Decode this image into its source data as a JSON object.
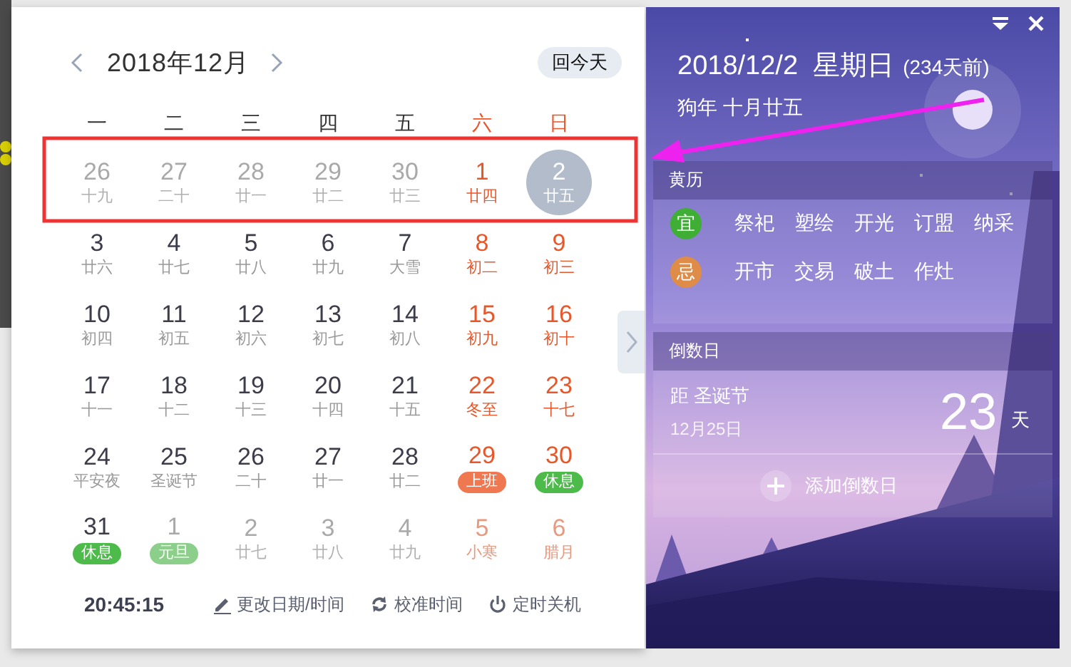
{
  "calendar": {
    "title": "2018年12月",
    "today_button": "回今天",
    "weekdays": [
      "一",
      "二",
      "三",
      "四",
      "五",
      "六",
      "日"
    ],
    "days": [
      {
        "day": "26",
        "label": "十九",
        "kind": "plain",
        "faded": true,
        "selected": false
      },
      {
        "day": "27",
        "label": "二十",
        "kind": "plain",
        "faded": true,
        "selected": false
      },
      {
        "day": "28",
        "label": "廿一",
        "kind": "plain",
        "faded": true,
        "selected": false
      },
      {
        "day": "29",
        "label": "廿二",
        "kind": "plain",
        "faded": true,
        "selected": false
      },
      {
        "day": "30",
        "label": "廿三",
        "kind": "plain",
        "faded": true,
        "selected": false
      },
      {
        "day": "1",
        "label": "廿四",
        "kind": "plain",
        "faded": false,
        "selected": false
      },
      {
        "day": "2",
        "label": "廿五",
        "kind": "plain",
        "faded": false,
        "selected": true
      },
      {
        "day": "3",
        "label": "廿六",
        "kind": "plain",
        "faded": false,
        "selected": false
      },
      {
        "day": "4",
        "label": "廿七",
        "kind": "plain",
        "faded": false,
        "selected": false
      },
      {
        "day": "5",
        "label": "廿八",
        "kind": "plain",
        "faded": false,
        "selected": false
      },
      {
        "day": "6",
        "label": "廿九",
        "kind": "plain",
        "faded": false,
        "selected": false
      },
      {
        "day": "7",
        "label": "大雪",
        "kind": "plain",
        "faded": false,
        "selected": false
      },
      {
        "day": "8",
        "label": "初二",
        "kind": "plain",
        "faded": false,
        "selected": false
      },
      {
        "day": "9",
        "label": "初三",
        "kind": "plain",
        "faded": false,
        "selected": false
      },
      {
        "day": "10",
        "label": "初四",
        "kind": "plain",
        "faded": false,
        "selected": false
      },
      {
        "day": "11",
        "label": "初五",
        "kind": "plain",
        "faded": false,
        "selected": false
      },
      {
        "day": "12",
        "label": "初六",
        "kind": "plain",
        "faded": false,
        "selected": false
      },
      {
        "day": "13",
        "label": "初七",
        "kind": "plain",
        "faded": false,
        "selected": false
      },
      {
        "day": "14",
        "label": "初八",
        "kind": "plain",
        "faded": false,
        "selected": false
      },
      {
        "day": "15",
        "label": "初九",
        "kind": "plain",
        "faded": false,
        "selected": false
      },
      {
        "day": "16",
        "label": "初十",
        "kind": "plain",
        "faded": false,
        "selected": false
      },
      {
        "day": "17",
        "label": "十一",
        "kind": "plain",
        "faded": false,
        "selected": false
      },
      {
        "day": "18",
        "label": "十二",
        "kind": "plain",
        "faded": false,
        "selected": false
      },
      {
        "day": "19",
        "label": "十三",
        "kind": "plain",
        "faded": false,
        "selected": false
      },
      {
        "day": "20",
        "label": "十四",
        "kind": "plain",
        "faded": false,
        "selected": false
      },
      {
        "day": "21",
        "label": "十五",
        "kind": "plain",
        "faded": false,
        "selected": false
      },
      {
        "day": "22",
        "label": "冬至",
        "kind": "plain",
        "faded": false,
        "selected": false
      },
      {
        "day": "23",
        "label": "十七",
        "kind": "plain",
        "faded": false,
        "selected": false
      },
      {
        "day": "24",
        "label": "平安夜",
        "kind": "plain",
        "faded": false,
        "selected": false
      },
      {
        "day": "25",
        "label": "圣诞节",
        "kind": "plain",
        "faded": false,
        "selected": false
      },
      {
        "day": "26",
        "label": "二十",
        "kind": "plain",
        "faded": false,
        "selected": false
      },
      {
        "day": "27",
        "label": "廿一",
        "kind": "plain",
        "faded": false,
        "selected": false
      },
      {
        "day": "28",
        "label": "廿二",
        "kind": "plain",
        "faded": false,
        "selected": false
      },
      {
        "day": "29",
        "label": "上班",
        "kind": "work",
        "faded": false,
        "selected": false
      },
      {
        "day": "30",
        "label": "休息",
        "kind": "rest",
        "faded": false,
        "selected": false
      },
      {
        "day": "31",
        "label": "休息",
        "kind": "rest",
        "faded": false,
        "selected": false
      },
      {
        "day": "1",
        "label": "元旦",
        "kind": "rest",
        "faded": true,
        "selected": false
      },
      {
        "day": "2",
        "label": "廿七",
        "kind": "plain",
        "faded": true,
        "selected": false
      },
      {
        "day": "3",
        "label": "廿八",
        "kind": "plain",
        "faded": true,
        "selected": false
      },
      {
        "day": "4",
        "label": "廿九",
        "kind": "plain",
        "faded": true,
        "selected": false
      },
      {
        "day": "5",
        "label": "小寒",
        "kind": "plain",
        "faded": true,
        "selected": false
      },
      {
        "day": "6",
        "label": "腊月",
        "kind": "plain",
        "faded": true,
        "selected": false
      }
    ],
    "clock": "20:45:15",
    "actions": [
      {
        "kind": "edit",
        "label": "更改日期/时间"
      },
      {
        "kind": "sync",
        "label": "校准时间"
      },
      {
        "kind": "power",
        "label": "定时关机"
      }
    ]
  },
  "panel": {
    "date": "2018/12/2  星期日",
    "ago": "(234天前)",
    "lunar": "狗年 十月廿五",
    "almanac": {
      "title": "黄历",
      "rows": [
        {
          "kind": "good",
          "mark": "宜",
          "items": [
            "祭祀",
            "塑绘",
            "开光",
            "订盟",
            "纳采"
          ]
        },
        {
          "kind": "bad",
          "mark": "忌",
          "items": [
            "开市",
            "交易",
            "破土",
            "作灶"
          ]
        }
      ]
    },
    "countdown": {
      "title": "倒数日",
      "items": [
        {
          "name": "距 圣诞节",
          "date": "12月25日",
          "days": "23",
          "unit": "天"
        }
      ],
      "add_button": "添加倒数日"
    }
  }
}
